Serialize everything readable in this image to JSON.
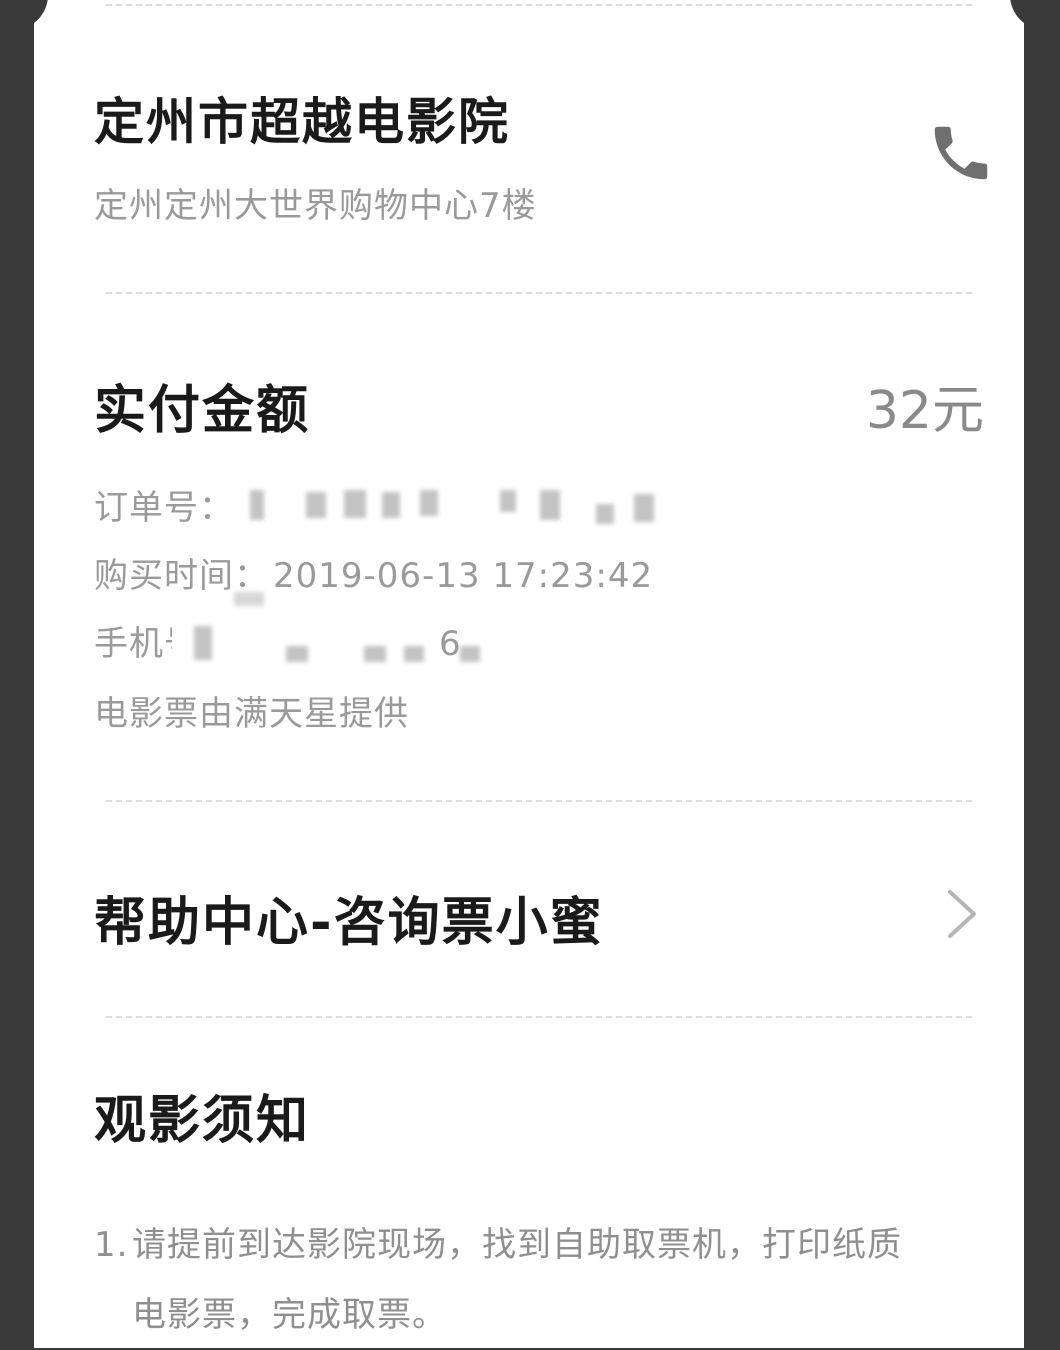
{
  "cinema": {
    "name": "定州市超越电影院",
    "address": "定州定州大世界购物中心7楼",
    "phone_icon": "phone-icon"
  },
  "payment": {
    "label": "实付金额",
    "amount": "32元"
  },
  "order": {
    "order_no_label": "订单号：",
    "purchase_time_label": "购买时间：",
    "purchase_time_value": "2019-06-13 17:23:42",
    "phone_label": "手机号",
    "phone_visible_tail": "6",
    "provider": "电影票由满天星提供"
  },
  "help": {
    "label": "帮助中心-咨询票小蜜",
    "chevron_icon": "chevron-right-icon"
  },
  "notice": {
    "title": "观影须知",
    "items": [
      {
        "num": "1.",
        "line1": "请提前到达影院现场，找到自助取票机，打印纸质",
        "line2": "电影票，完成取票。"
      }
    ]
  }
}
